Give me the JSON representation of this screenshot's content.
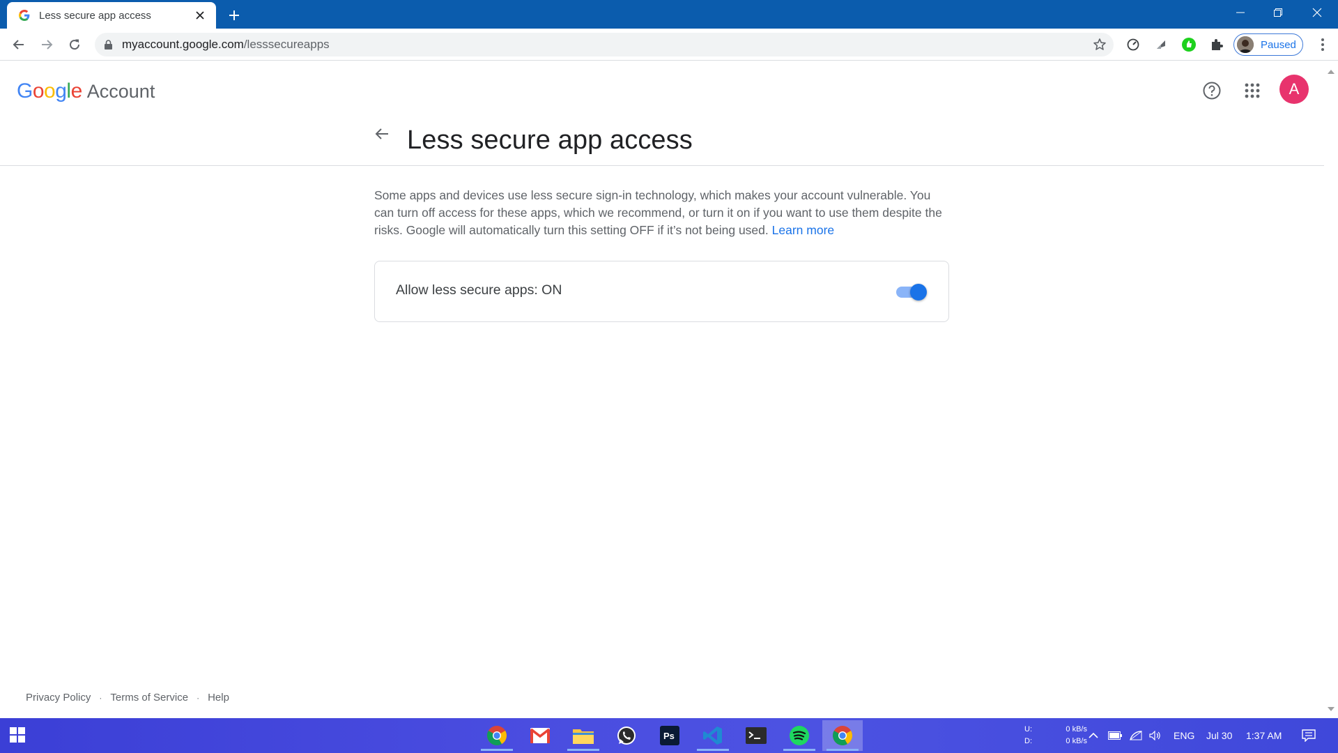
{
  "browser": {
    "tab_title": "Less secure app access",
    "url_domain": "myaccount.google.com",
    "url_path": "/lesssecureapps",
    "profile_label": "Paused"
  },
  "header": {
    "logo_letters": [
      "G",
      "o",
      "o",
      "g",
      "l",
      "e"
    ],
    "logo_colors": [
      "#4285F4",
      "#EA4335",
      "#FBBC05",
      "#4285F4",
      "#34A853",
      "#EA4335"
    ],
    "product": "Account",
    "avatar_letter": "A",
    "avatar_color": "#e8336d"
  },
  "main": {
    "title": "Less secure app access",
    "description": "Some apps and devices use less secure sign-in technology, which makes your account vulnerable. You can turn off access for these apps, which we recommend, or turn it on if you want to use them despite the risks. Google will automatically turn this setting OFF if it’s not being used.",
    "learn_more": "Learn more",
    "setting_label": "Allow less secure apps: ON",
    "setting_enabled": true
  },
  "footer": {
    "links": [
      "Privacy Policy",
      "Terms of Service",
      "Help"
    ],
    "separator": "·"
  },
  "taskbar": {
    "apps": [
      "chrome-icon",
      "gmail-icon",
      "file-explorer-icon",
      "whatsapp-icon",
      "photoshop-icon",
      "vscode-icon",
      "terminal-icon",
      "spotify-icon",
      "chrome-active-icon"
    ],
    "upload_label": "U:",
    "download_label": "D:",
    "upload_speed": "0 kB/s",
    "download_speed": "0 kB/s",
    "language": "ENG",
    "date": "Jul 30",
    "time": "1:37 AM"
  },
  "colors": {
    "titlebar": "#0b5cad",
    "accent": "#1a73e8",
    "taskbar": "#4a4de0"
  }
}
